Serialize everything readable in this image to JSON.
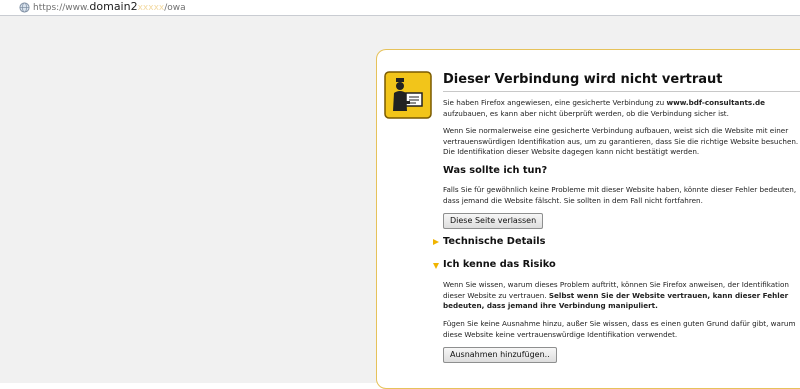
{
  "address_bar": {
    "prefix": "https://www.",
    "host": "domain2",
    "masked": "xxxxx",
    "suffix": "/owa"
  },
  "error_page": {
    "title": "Dieser Verbindung wird nicht vertraut",
    "intro_before": "Sie haben Firefox angewiesen, eine gesicherte Verbindung zu ",
    "intro_host": "www.bdf-consultants.de",
    "intro_after": " aufzubauen, es kann aber nicht überprüft werden, ob die Verbindung sicher ist.",
    "explanation": "Wenn Sie normalerweise eine gesicherte Verbindung aufbauen, weist sich die Website mit einer vertrauenswürdigen Identifikation aus, um zu garantieren, dass Sie die richtige Website besuchen. Die Identifikation dieser Website dagegen kann nicht bestätigt werden.",
    "what_heading": "Was sollte ich tun?",
    "what_text": "Falls Sie für gewöhnlich keine Probleme mit dieser Website haben, könnte dieser Fehler bedeuten, dass jemand die Website fälscht. Sie sollten in dem Fall nicht fortfahren.",
    "leave_button": "Diese Seite verlassen",
    "technical_heading": "Technische Details",
    "risk_heading": "Ich kenne das Risiko",
    "risk_text_plain": "Wenn Sie wissen, warum dieses Problem auftritt, können Sie Firefox anweisen, der Identifikation dieser Website zu vertrauen. ",
    "risk_text_bold": "Selbst wenn Sie der Website vertrauen, kann dieser Fehler bedeuten, dass jemand ihre Verbindung manipuliert.",
    "exception_text": "Fügen Sie keine Ausnahme hinzu, außer Sie wissen, dass es einen guten Grund dafür gibt, warum diese Website keine vertrauenswürdige Identifikation verwendet.",
    "add_exception_button": "Ausnahmen hinzufügen.."
  },
  "colors": {
    "box_border": "#e6c25a",
    "arrow": "#f0b400",
    "icon_bg": "#f2c51a",
    "page_bg": "#f1f1f1"
  },
  "icons": {
    "address_bar": "globe-icon",
    "warning": "police-officer-warning-icon",
    "collapsed_section": "triangle-right-icon",
    "expanded_section": "triangle-down-icon"
  }
}
